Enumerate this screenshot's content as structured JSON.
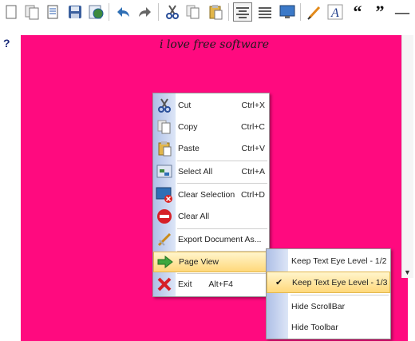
{
  "toolbar": {
    "buttons": [
      "new-document",
      "copy-documents",
      "clipboard-document",
      "save",
      "save-as-web",
      "undo",
      "redo",
      "cut",
      "copy",
      "paste",
      "align-center",
      "justify",
      "monitor",
      "pencil",
      "text-style",
      "quote-open",
      "quote-close",
      "minimize"
    ],
    "quote_open": "“",
    "quote_close": "”",
    "minimize": "—"
  },
  "help": {
    "label": "?"
  },
  "document": {
    "title": "i love free software",
    "background": "#ff0a7f"
  },
  "context_menu": {
    "items": [
      {
        "label": "Cut",
        "shortcut": "Ctrl+X",
        "icon": "scissors-icon"
      },
      {
        "label": "Copy",
        "shortcut": "Ctrl+C",
        "icon": "copy-icon"
      },
      {
        "label": "Paste",
        "shortcut": "Ctrl+V",
        "icon": "paste-icon"
      },
      {
        "label": "Select All",
        "shortcut": "Ctrl+A",
        "icon": "select-all-icon"
      },
      {
        "label": "Clear Selection",
        "shortcut": "Ctrl+D",
        "icon": "clear-selection-icon"
      },
      {
        "label": "Clear All",
        "shortcut": "",
        "icon": "no-entry-icon"
      },
      {
        "label": "Export Document As...",
        "shortcut": "",
        "icon": "export-icon"
      },
      {
        "label": "Page View",
        "shortcut": "",
        "icon": "arrow-right-icon"
      },
      {
        "label": "Exit",
        "shortcut": "Alt+F4",
        "icon": "red-x-icon"
      }
    ]
  },
  "page_view_submenu": {
    "items": [
      {
        "label": "Keep Text Eye Level - 1/2",
        "checked": false
      },
      {
        "label": "Keep Text Eye Level - 1/3",
        "checked": true
      },
      {
        "label": "Hide ScrollBar",
        "checked": false
      },
      {
        "label": "Hide Toolbar",
        "checked": false
      }
    ],
    "check_mark": "✔"
  }
}
